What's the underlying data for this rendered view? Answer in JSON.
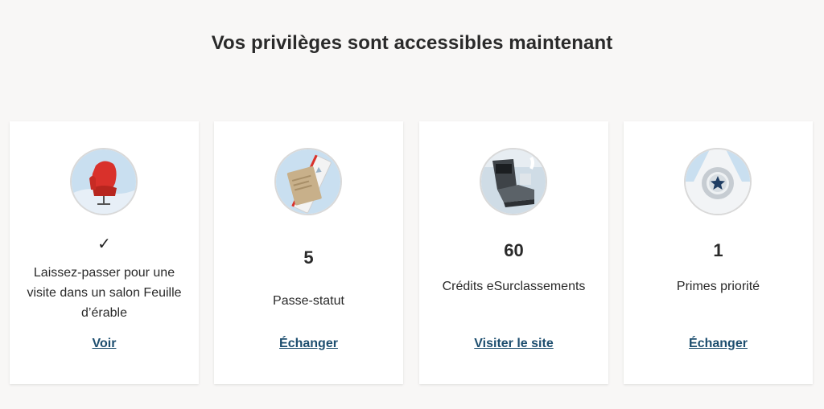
{
  "page": {
    "title": "Vos privilèges sont accessibles maintenant"
  },
  "cards": [
    {
      "icon": "lounge-chair-icon",
      "check": "✓",
      "description": "Laissez-passer pour une visite dans un salon Feuille d’érable",
      "link": "Voir"
    },
    {
      "icon": "status-pass-icon",
      "value": "5",
      "description": "Passe-statut",
      "link": "Échanger"
    },
    {
      "icon": "airplane-seat-icon",
      "value": "60",
      "description": "Crédits eSurclassements",
      "link": "Visiter le site"
    },
    {
      "icon": "star-medal-icon",
      "value": "1",
      "description": "Primes priorité",
      "link": "Échanger"
    }
  ],
  "colors": {
    "background": "#f8f7f6",
    "card": "#ffffff",
    "link": "#1d4e6f",
    "accent_red": "#d9312b",
    "sky_blue": "#bcd7ec"
  }
}
